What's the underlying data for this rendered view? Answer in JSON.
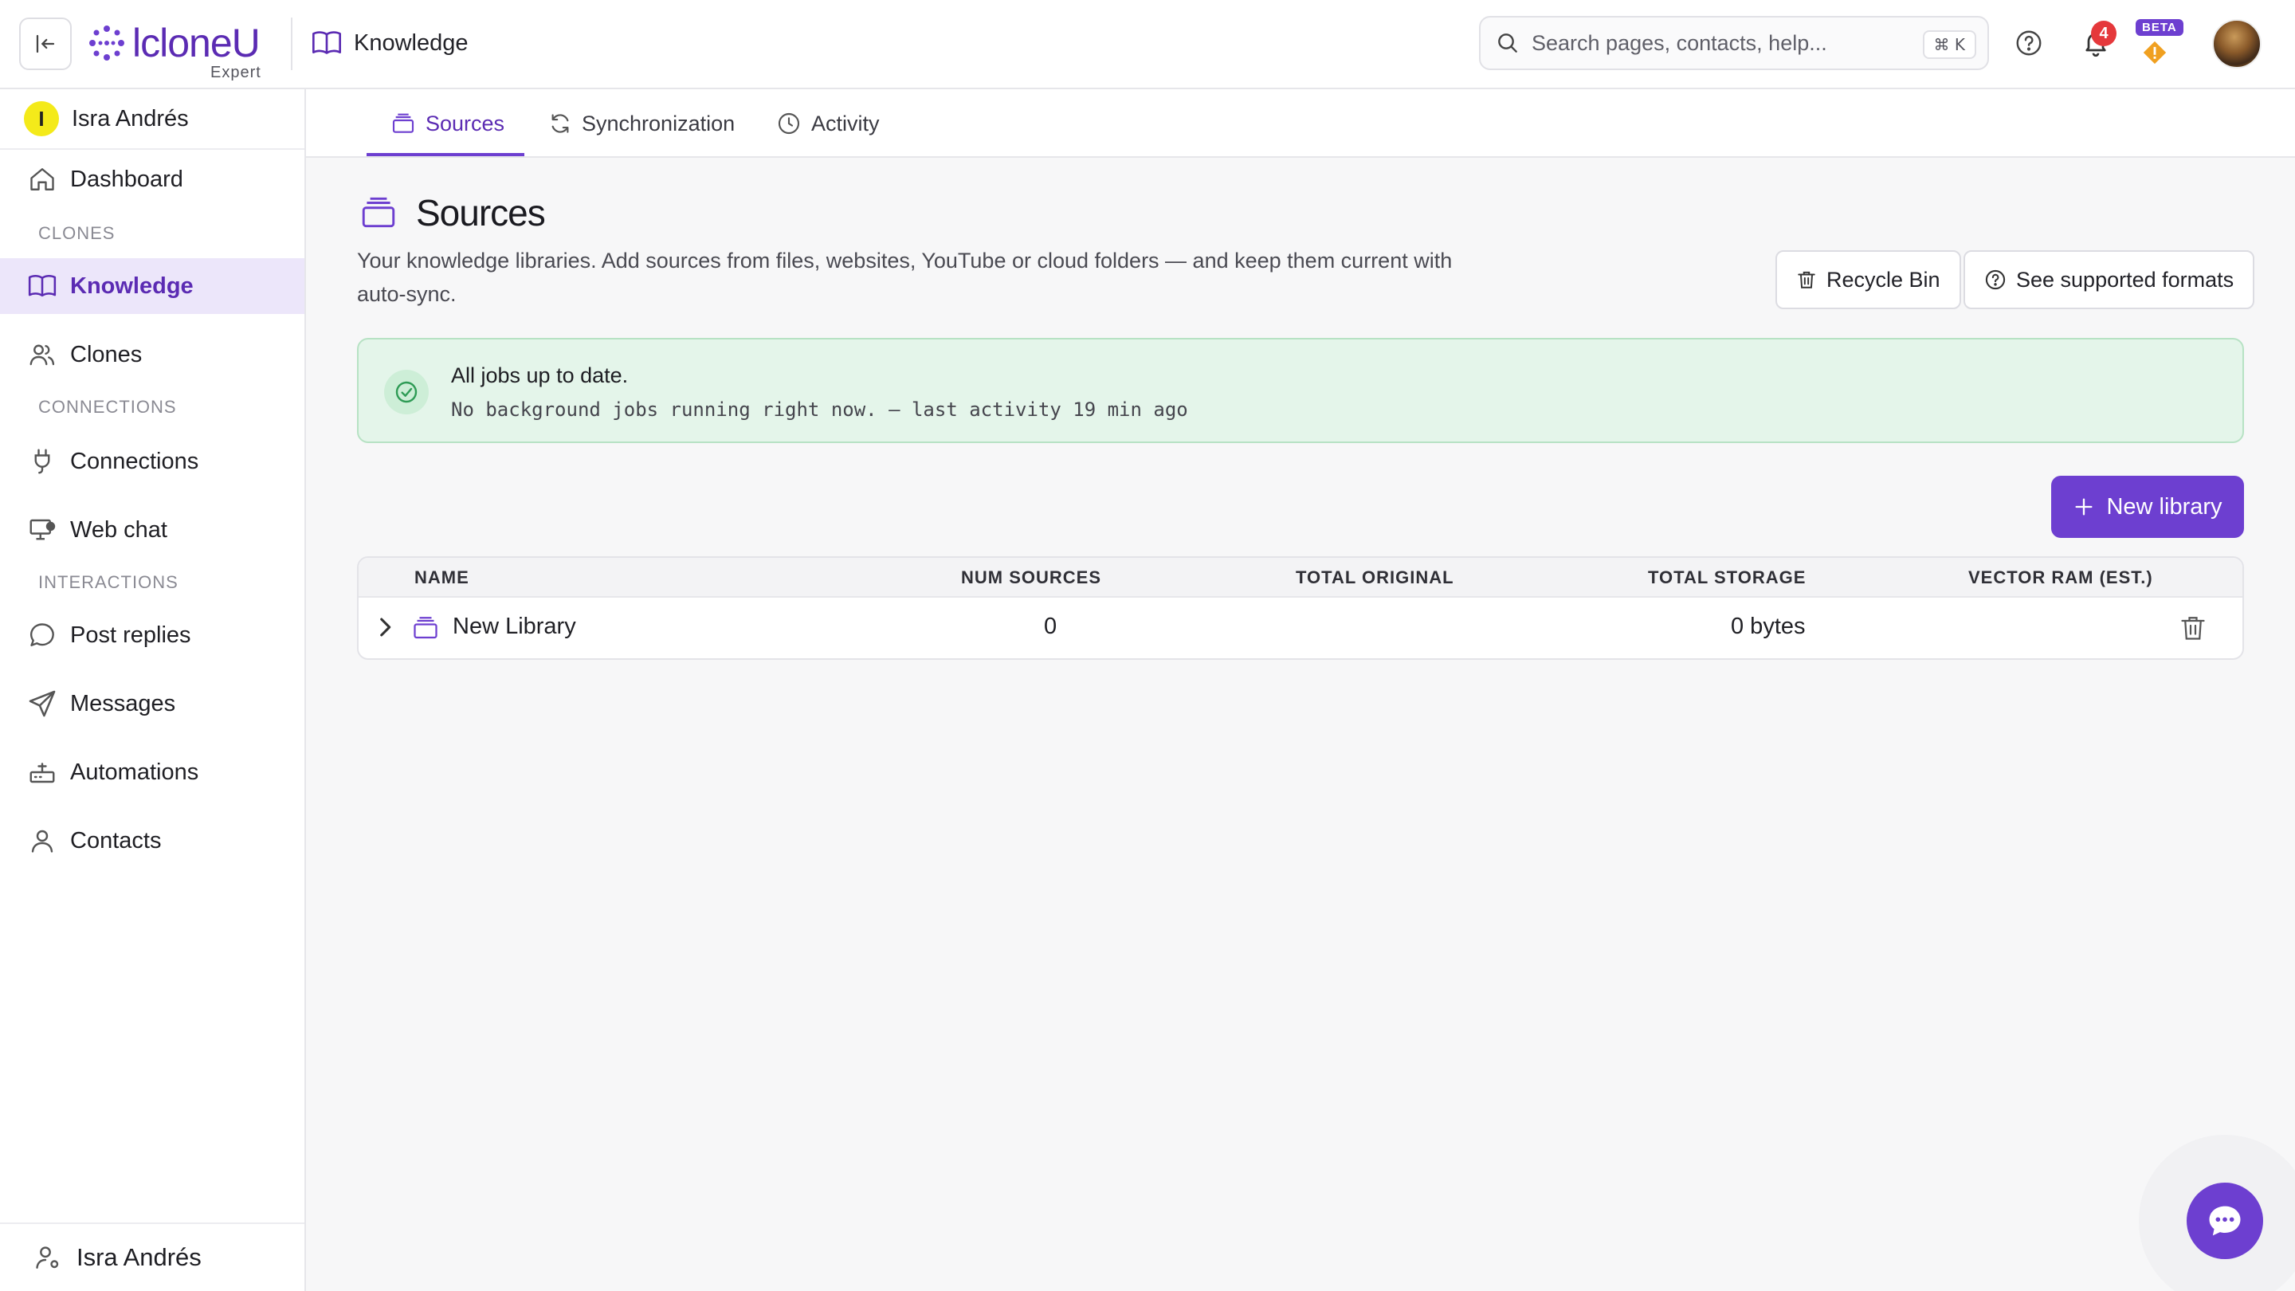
{
  "app": {
    "logo_text": "lcloneU",
    "logo_sub": "Expert",
    "breadcrumb": "Knowledge",
    "search_placeholder": "Search pages, contacts, help...",
    "search_shortcut": "⌘ K",
    "notification_count": "4",
    "beta_label": "BETA"
  },
  "sidebar": {
    "org_initial": "I",
    "org_name": "Isra Andrés",
    "items": [
      {
        "label": "Dashboard",
        "icon": "home-icon"
      },
      {
        "label": "Knowledge",
        "icon": "book-icon",
        "active": true
      },
      {
        "label": "Clones",
        "icon": "users-icon"
      },
      {
        "label": "Connections",
        "icon": "plug-icon"
      },
      {
        "label": "Web chat",
        "icon": "monitor-chat-icon"
      },
      {
        "label": "Post replies",
        "icon": "message-circle-icon"
      },
      {
        "label": "Messages",
        "icon": "send-icon"
      },
      {
        "label": "Automations",
        "icon": "router-icon"
      },
      {
        "label": "Contacts",
        "icon": "user-icon"
      }
    ],
    "sections": [
      "CLONES",
      "CONNECTIONS",
      "INTERACTIONS"
    ],
    "footer_user": "Isra Andrés"
  },
  "tabs": [
    {
      "label": "Sources",
      "active": true
    },
    {
      "label": "Synchronization"
    },
    {
      "label": "Activity"
    }
  ],
  "main": {
    "title": "Sources",
    "description": "Your knowledge libraries. Add sources from files, websites, YouTube or cloud folders — and keep them current with auto-sync.",
    "recycle_bin_label": "Recycle Bin",
    "formats_label": "See supported formats",
    "status": {
      "title": "All jobs up to date.",
      "subtitle": "No background jobs running right now. — last activity 19 min ago"
    },
    "new_library_label": "New library",
    "table": {
      "columns": [
        "NAME",
        "NUM SOURCES",
        "TOTAL ORIGINAL",
        "TOTAL STORAGE",
        "VECTOR RAM (EST.)"
      ],
      "rows": [
        {
          "name": "New Library",
          "num_sources": "0",
          "total_original": "",
          "total_storage": "0 bytes",
          "vector_ram": ""
        }
      ]
    }
  },
  "colors": {
    "accent": "#6d3fd0",
    "accent_text": "#5b2bb3",
    "active_bg": "#ece6fa",
    "success_bg": "#e4f5ea",
    "success_icon": "#2e9b55"
  }
}
